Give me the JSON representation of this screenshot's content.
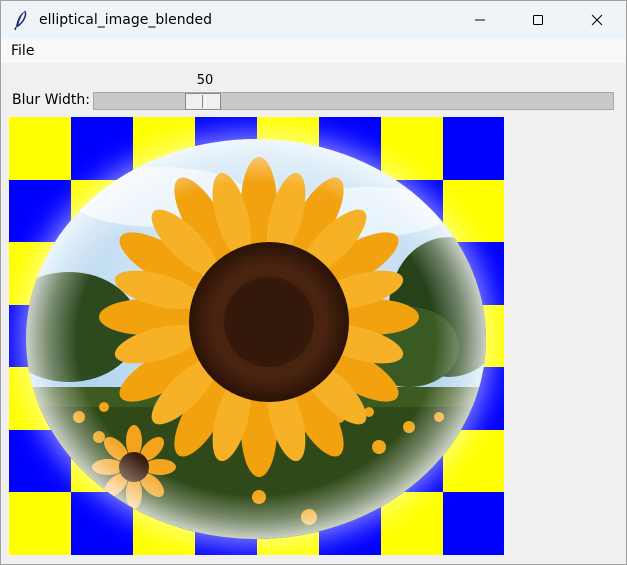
{
  "window": {
    "title": "elliptical_image_blended"
  },
  "menu": {
    "file_label": "File"
  },
  "slider": {
    "label": "Blur Width:",
    "value": "50"
  },
  "colors": {
    "checker_yellow": "#ffff00",
    "checker_blue": "#0000ff",
    "titlebar_bg": "#eff4f9",
    "window_bg": "#f0f0f0"
  },
  "icons": {
    "app": "feather-icon",
    "minimize": "minimize-icon",
    "maximize": "maximize-icon",
    "close": "close-icon"
  }
}
